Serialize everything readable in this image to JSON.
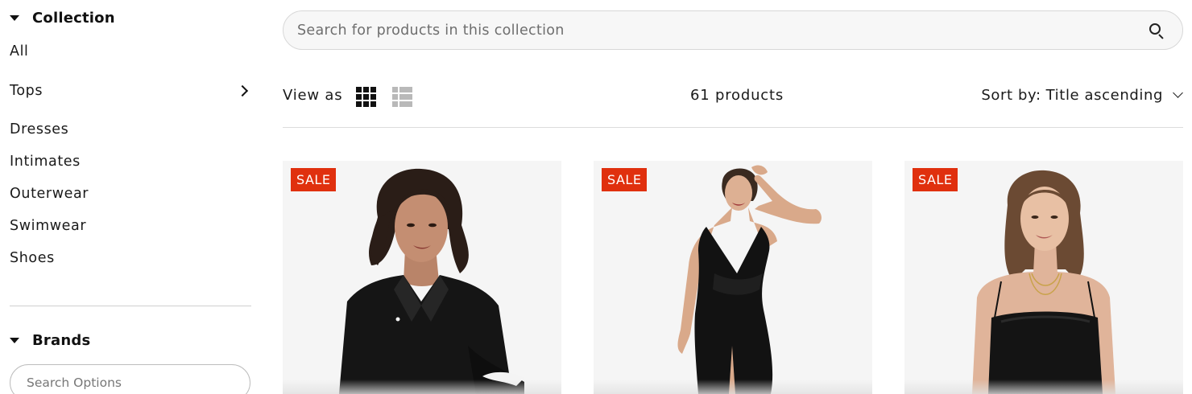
{
  "sidebar": {
    "collection_title": "Collection",
    "categories": [
      {
        "label": "All",
        "has_children": false
      },
      {
        "label": "Tops",
        "has_children": true
      },
      {
        "label": "Dresses",
        "has_children": false
      },
      {
        "label": "Intimates",
        "has_children": false
      },
      {
        "label": "Outerwear",
        "has_children": false
      },
      {
        "label": "Swimwear",
        "has_children": false
      },
      {
        "label": "Shoes",
        "has_children": false
      }
    ],
    "brands_title": "Brands",
    "brands_search_placeholder": "Search Options"
  },
  "search": {
    "placeholder": "Search for products in this collection",
    "icon": "search-icon"
  },
  "toolbar": {
    "view_as_label": "View as",
    "view_modes": [
      {
        "icon": "grid-view-icon",
        "active": true
      },
      {
        "icon": "list-view-icon",
        "active": false
      }
    ],
    "product_count": "61 products",
    "sort_label": "Sort by:",
    "sort_value": "Title ascending"
  },
  "products": [
    {
      "badge": "SALE",
      "image": "woman in black satin button-down shirt"
    },
    {
      "badge": "SALE",
      "image": "woman in black sleeveless wrap dress"
    },
    {
      "badge": "SALE",
      "image": "woman in black spaghetti-strap top"
    }
  ],
  "colors": {
    "sale_badge": "#e0300e",
    "card_bg": "#f5f5f5",
    "search_bg": "#f7f7f7"
  }
}
